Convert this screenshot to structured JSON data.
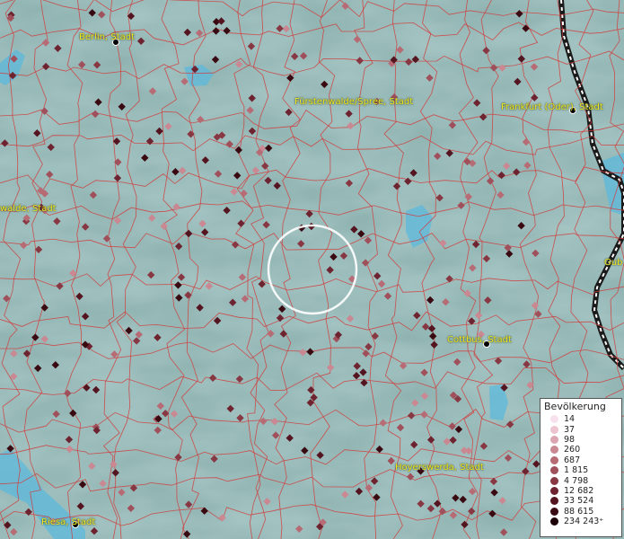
{
  "cities": [
    {
      "name": "Berlin, Stadt"
    },
    {
      "name": "Fürstenwalde/Spree, Stadt"
    },
    {
      "name": "Frankfurt (Oder), Stadt"
    },
    {
      "name": "walde, Stadt"
    },
    {
      "name": "Gub"
    },
    {
      "name": "Cottbus, Stadt"
    },
    {
      "name": "Hoyerswerda, Stadt"
    },
    {
      "name": "Riesa, Stadt"
    }
  ],
  "legend": {
    "title": "Bevölkerung",
    "items": [
      {
        "label": "14",
        "color": "#f7e1ec"
      },
      {
        "label": "37",
        "color": "#ecc3cf"
      },
      {
        "label": "98",
        "color": "#dba6b1"
      },
      {
        "label": "260",
        "color": "#c98892"
      },
      {
        "label": "687",
        "color": "#b66b75"
      },
      {
        "label": "1 815",
        "color": "#a0505b"
      },
      {
        "label": "4 798",
        "color": "#883843"
      },
      {
        "label": "12 682",
        "color": "#6e2430"
      },
      {
        "label": "33 524",
        "color": "#551520"
      },
      {
        "label": "88 615",
        "color": "#3a0a12"
      },
      {
        "label": "234 243⁺",
        "color": "#1c0208"
      }
    ]
  },
  "colors": {
    "boundary": "#d23a3a",
    "water": "#5cb8dc",
    "terrain": "#8fb3b1",
    "border_dark": "#1a1a1a",
    "selection_ring": "#ffffff"
  }
}
